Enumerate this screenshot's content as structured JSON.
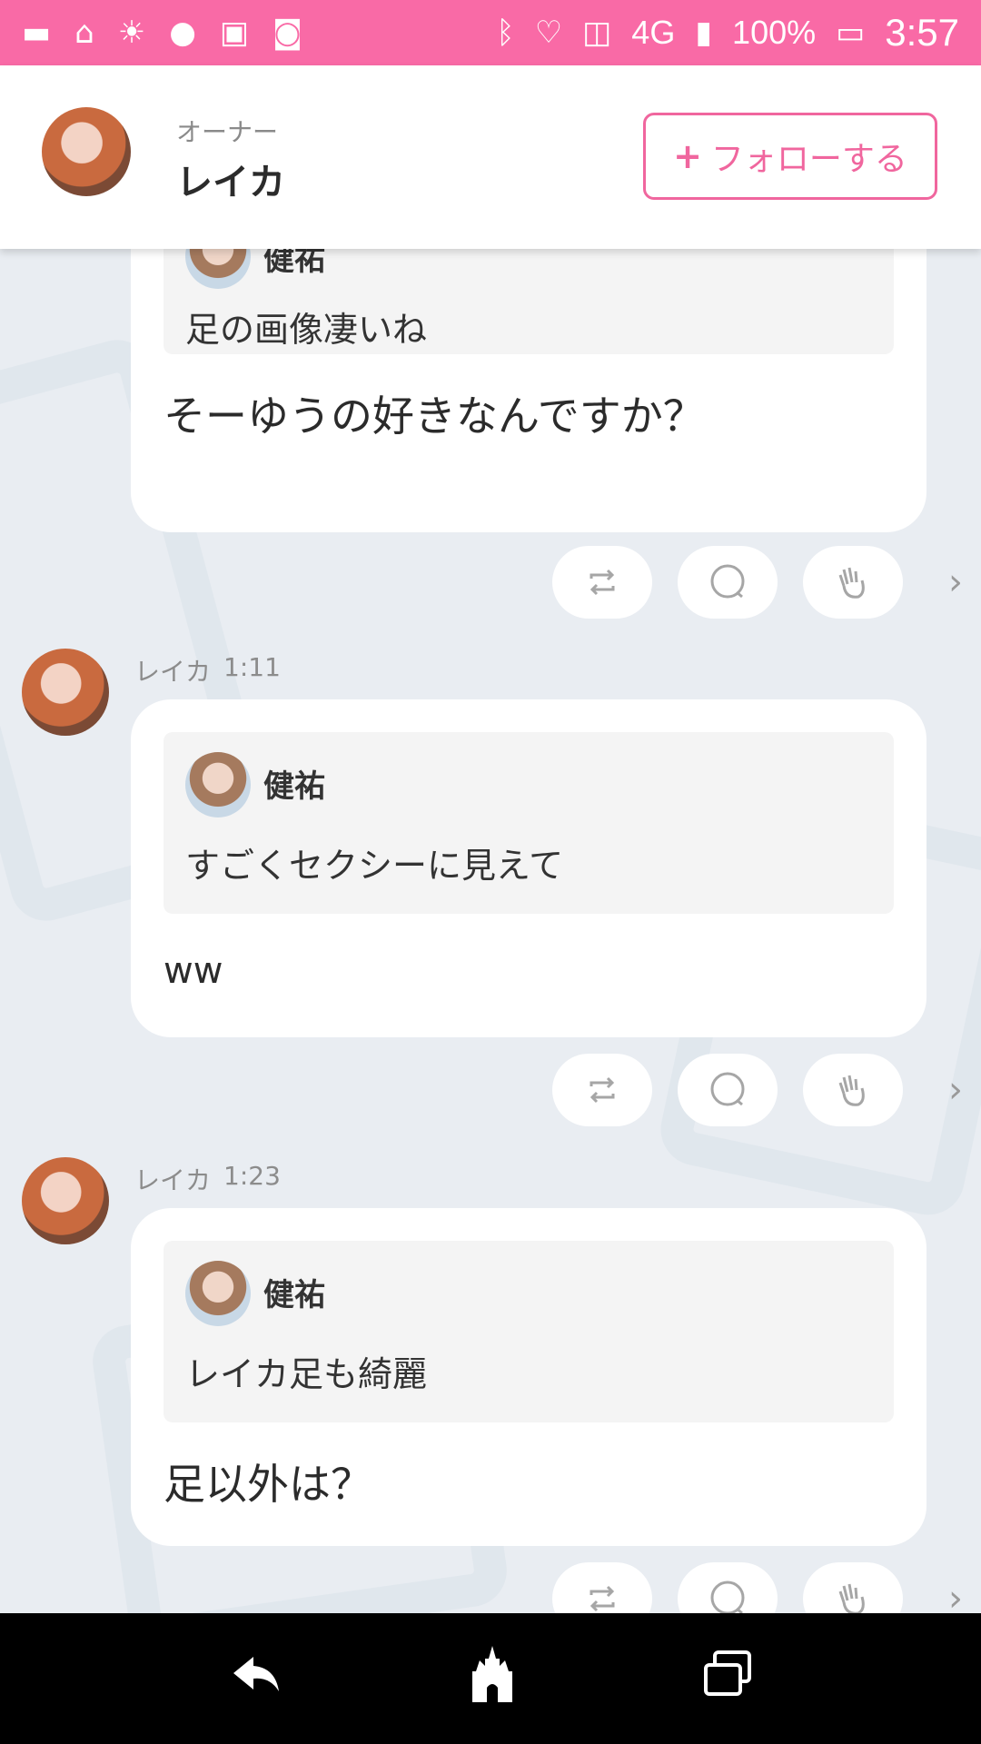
{
  "status_bar": {
    "battery": "100%",
    "time": "3:57",
    "network": "4G"
  },
  "header": {
    "owner_role": "オーナー",
    "owner_name": "レイカ",
    "follow_label": "フォローする",
    "follow_plus": "+"
  },
  "messages": [
    {
      "author": "",
      "time": "",
      "quote_author": "健祐",
      "quote_text": "足の画像凄いね",
      "text": "そーゆうの好きなんですか？"
    },
    {
      "author": "レイカ",
      "time": "1:11",
      "quote_author": "健祐",
      "quote_text": "すごくセクシーに見えて",
      "text": "ww"
    },
    {
      "author": "レイカ",
      "time": "1:23",
      "quote_author": "健祐",
      "quote_text": "レイカ足も綺麗",
      "text": "足以外は？"
    }
  ],
  "colors": {
    "accent": "#f96aa6",
    "follow": "#f0669e",
    "background": "#e9edf2"
  }
}
